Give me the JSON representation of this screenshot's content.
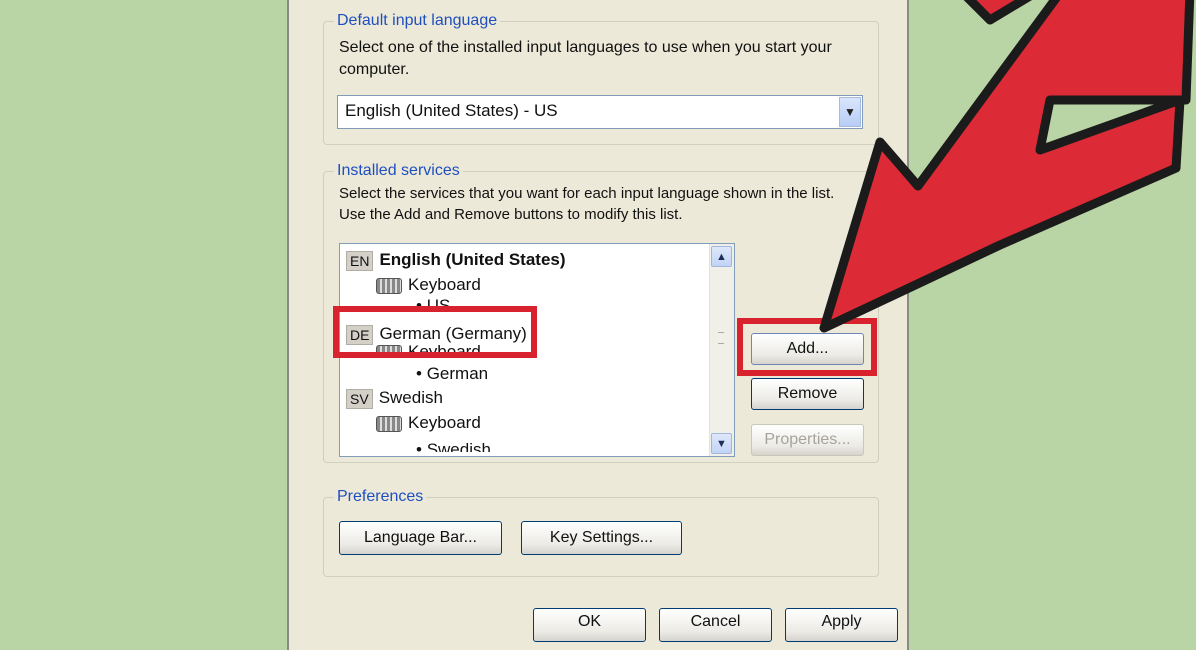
{
  "default_input": {
    "group_label": "Default input language",
    "description": "Select one of the installed input languages to use when you start your computer.",
    "selected": "English (United States) - US"
  },
  "installed_services": {
    "group_label": "Installed services",
    "description": "Select the services that you want for each input language shown in the list. Use the Add and Remove buttons to modify this list.",
    "items": [
      {
        "code": "EN",
        "label": "English (United States)"
      },
      {
        "label": "Keyboard"
      },
      {
        "label": "US"
      },
      {
        "code": "DE",
        "label": "German (Germany)"
      },
      {
        "label": "Keyboard"
      },
      {
        "label": "German"
      },
      {
        "code": "SV",
        "label": "Swedish"
      },
      {
        "label": "Keyboard"
      },
      {
        "label": "Swedish"
      }
    ],
    "buttons": {
      "add": "Add...",
      "remove": "Remove",
      "properties": "Properties..."
    }
  },
  "preferences": {
    "group_label": "Preferences",
    "language_bar": "Language Bar...",
    "key_settings": "Key Settings..."
  },
  "footer": {
    "ok": "OK",
    "cancel": "Cancel",
    "apply": "Apply"
  },
  "colors": {
    "highlight": "#d8222d",
    "background": "#b9d4a5",
    "dialog": "#ece9d8",
    "group_label": "#1f4fbf"
  },
  "icons": [
    "keyboard-icon",
    "chevron-down-icon",
    "chevron-up-icon",
    "red-pointer-arrow"
  ]
}
